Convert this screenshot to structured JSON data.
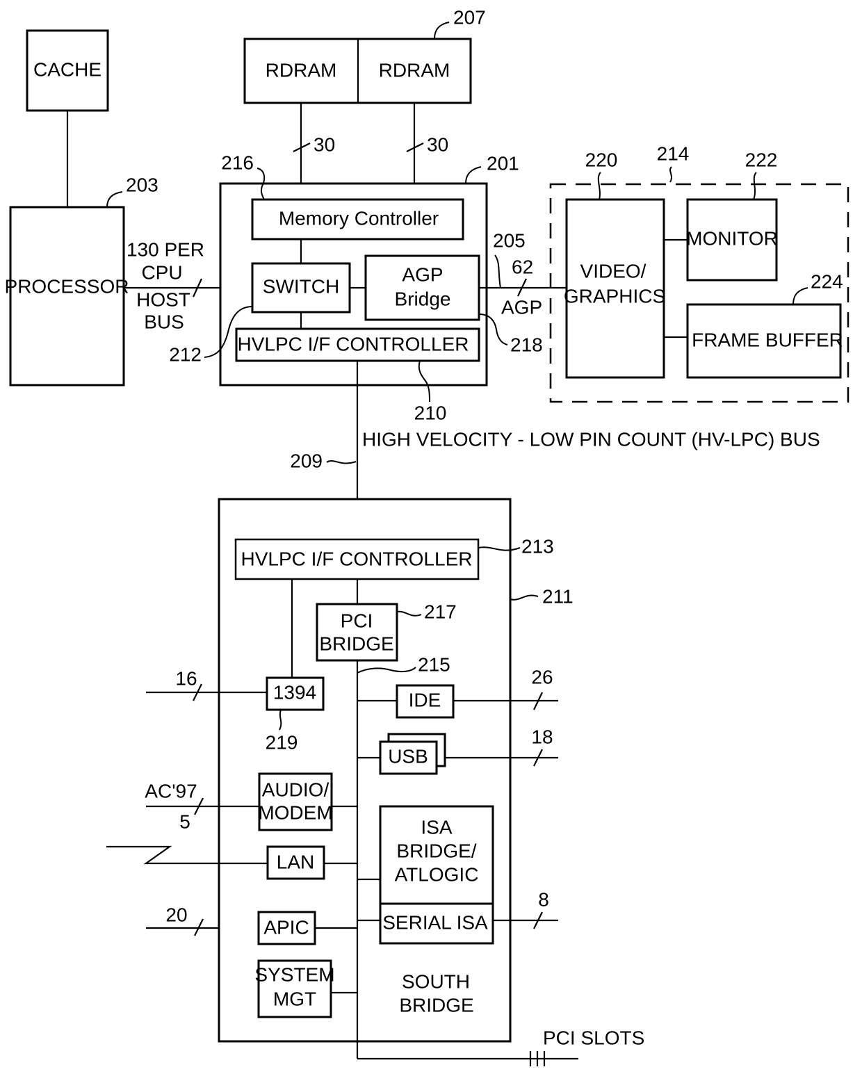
{
  "blocks": {
    "cache": "CACHE",
    "processor": "PROCESSOR",
    "rdram_1": "RDRAM",
    "rdram_2": "RDRAM",
    "memory_controller": "Memory Controller",
    "switch": "SWITCH",
    "agp_bridge_1": "AGP",
    "agp_bridge_2": "Bridge",
    "north_hvlpc": "HVLPC I/F CONTROLLER",
    "video_graphics_1": "VIDEO/",
    "video_graphics_2": "GRAPHICS",
    "monitor": "MONITOR",
    "frame_buffer": "FRAME BUFFER",
    "south_hvlpc": "HVLPC I/F CONTROLLER",
    "pci_bridge_1": "PCI",
    "pci_bridge_2": "BRIDGE",
    "ieee1394": "1394",
    "ide": "IDE",
    "usb": "USB",
    "audio_modem_1": "AUDIO/",
    "audio_modem_2": "MODEM",
    "lan": "LAN",
    "isa_bridge_1": "ISA",
    "isa_bridge_2": "BRIDGE/",
    "isa_bridge_3": "ATLOGIC",
    "serial_isa": "SERIAL ISA",
    "apic": "APIC",
    "system_mgt_1": "SYSTEM",
    "system_mgt_2": "MGT",
    "south_bridge_1": "SOUTH",
    "south_bridge_2": "BRIDGE"
  },
  "bus_labels": {
    "host_bus_1": "130 PER",
    "host_bus_2": "CPU",
    "host_bus_3": "HOST",
    "host_bus_4": "BUS",
    "rdram_bus_1": "30",
    "rdram_bus_2": "30",
    "agp_width": "62",
    "agp": "AGP",
    "hvlpc_bus": "HIGH VELOCITY - LOW PIN COUNT (HV-LPC) BUS",
    "ieee1394_width": "16",
    "ide_width": "26",
    "usb_width": "18",
    "ac97": "AC'97",
    "ac97_width": "5",
    "apic_width": "20",
    "serial_isa_width": "8",
    "pci_slots": "PCI SLOTS"
  },
  "reference_numerals": {
    "r203": "203",
    "r207": "207",
    "r216": "216",
    "r201": "201",
    "r205": "205",
    "r212": "212",
    "r218": "218",
    "r210": "210",
    "r209": "209",
    "r214": "214",
    "r220": "220",
    "r222": "222",
    "r224": "224",
    "r213": "213",
    "r211": "211",
    "r217": "217",
    "r215": "215",
    "r219": "219"
  }
}
